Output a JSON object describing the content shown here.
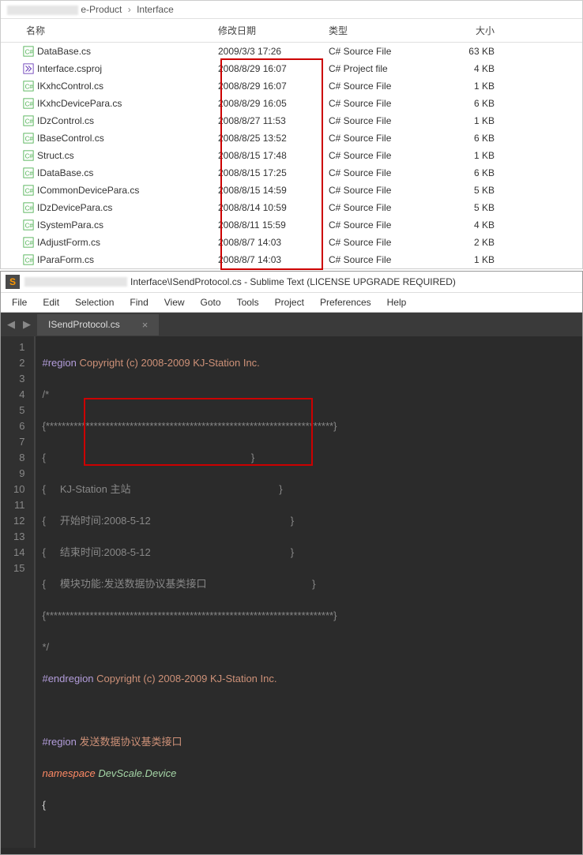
{
  "breadcrumb": {
    "part1_suffix": "e-Product",
    "part2": "Interface"
  },
  "columns": {
    "name": "名称",
    "date": "修改日期",
    "type": "类型",
    "size": "大小"
  },
  "files": [
    {
      "icon": "cs",
      "name": "DataBase.cs",
      "date": "2009/3/3 17:26",
      "type": "C# Source File",
      "size": "63 KB"
    },
    {
      "icon": "proj",
      "name": "Interface.csproj",
      "date": "2008/8/29 16:07",
      "type": "C# Project file",
      "size": "4 KB"
    },
    {
      "icon": "cs",
      "name": "IKxhcControl.cs",
      "date": "2008/8/29 16:07",
      "type": "C# Source File",
      "size": "1 KB"
    },
    {
      "icon": "cs",
      "name": "IKxhcDevicePara.cs",
      "date": "2008/8/29 16:05",
      "type": "C# Source File",
      "size": "6 KB"
    },
    {
      "icon": "cs",
      "name": "IDzControl.cs",
      "date": "2008/8/27 11:53",
      "type": "C# Source File",
      "size": "1 KB"
    },
    {
      "icon": "cs",
      "name": "IBaseControl.cs",
      "date": "2008/8/25 13:52",
      "type": "C# Source File",
      "size": "6 KB"
    },
    {
      "icon": "cs",
      "name": "Struct.cs",
      "date": "2008/8/15 17:48",
      "type": "C# Source File",
      "size": "1 KB"
    },
    {
      "icon": "cs",
      "name": "IDataBase.cs",
      "date": "2008/8/15 17:25",
      "type": "C# Source File",
      "size": "6 KB"
    },
    {
      "icon": "cs",
      "name": "ICommonDevicePara.cs",
      "date": "2008/8/15 14:59",
      "type": "C# Source File",
      "size": "5 KB"
    },
    {
      "icon": "cs",
      "name": "IDzDevicePara.cs",
      "date": "2008/8/14 10:59",
      "type": "C# Source File",
      "size": "5 KB"
    },
    {
      "icon": "cs",
      "name": "ISystemPara.cs",
      "date": "2008/8/11 15:59",
      "type": "C# Source File",
      "size": "4 KB"
    },
    {
      "icon": "cs",
      "name": "IAdjustForm.cs",
      "date": "2008/8/7 14:03",
      "type": "C# Source File",
      "size": "2 KB"
    },
    {
      "icon": "cs",
      "name": "IParaForm.cs",
      "date": "2008/8/7 14:03",
      "type": "C# Source File",
      "size": "1 KB"
    }
  ],
  "sublime": {
    "title_path": "Interface\\ISendProtocol.cs - Sublime Text (LICENSE UPGRADE REQUIRED)",
    "menu": [
      "File",
      "Edit",
      "Selection",
      "Find",
      "View",
      "Goto",
      "Tools",
      "Project",
      "Preferences",
      "Help"
    ],
    "tab": "ISendProtocol.cs"
  },
  "code": {
    "l1a": "#region",
    "l1b": " Copyright (c) 2008-2009 KJ-Station Inc.",
    "l2": "/*",
    "l3a": "{",
    "l3b": "************************************************************************",
    "l3c": "}",
    "l4a": "{",
    "l4b": "}",
    "l5a": "{",
    "l5b": "KJ-Station 主站",
    "l5c": "}",
    "l6a": "{",
    "l6b": "开始时间:2008-5-12",
    "l6c": "}",
    "l7a": "{",
    "l7b": "结束时间:2008-5-12",
    "l7c": "}",
    "l8a": "{",
    "l8b": "模块功能:发送数据协议基类接口",
    "l8c": "}",
    "l9a": "{",
    "l9b": "************************************************************************",
    "l9c": "}",
    "l10": "*/",
    "l11a": "#endregion",
    "l11b": " Copyright (c) 2008-2009 KJ-Station Inc.",
    "l12": "",
    "l13a": "#region",
    "l13b": " 发送数据协议基类接口",
    "l14a": "namespace",
    "l14b": " ",
    "l14c": "DevScale.Device",
    "l15": "{"
  }
}
